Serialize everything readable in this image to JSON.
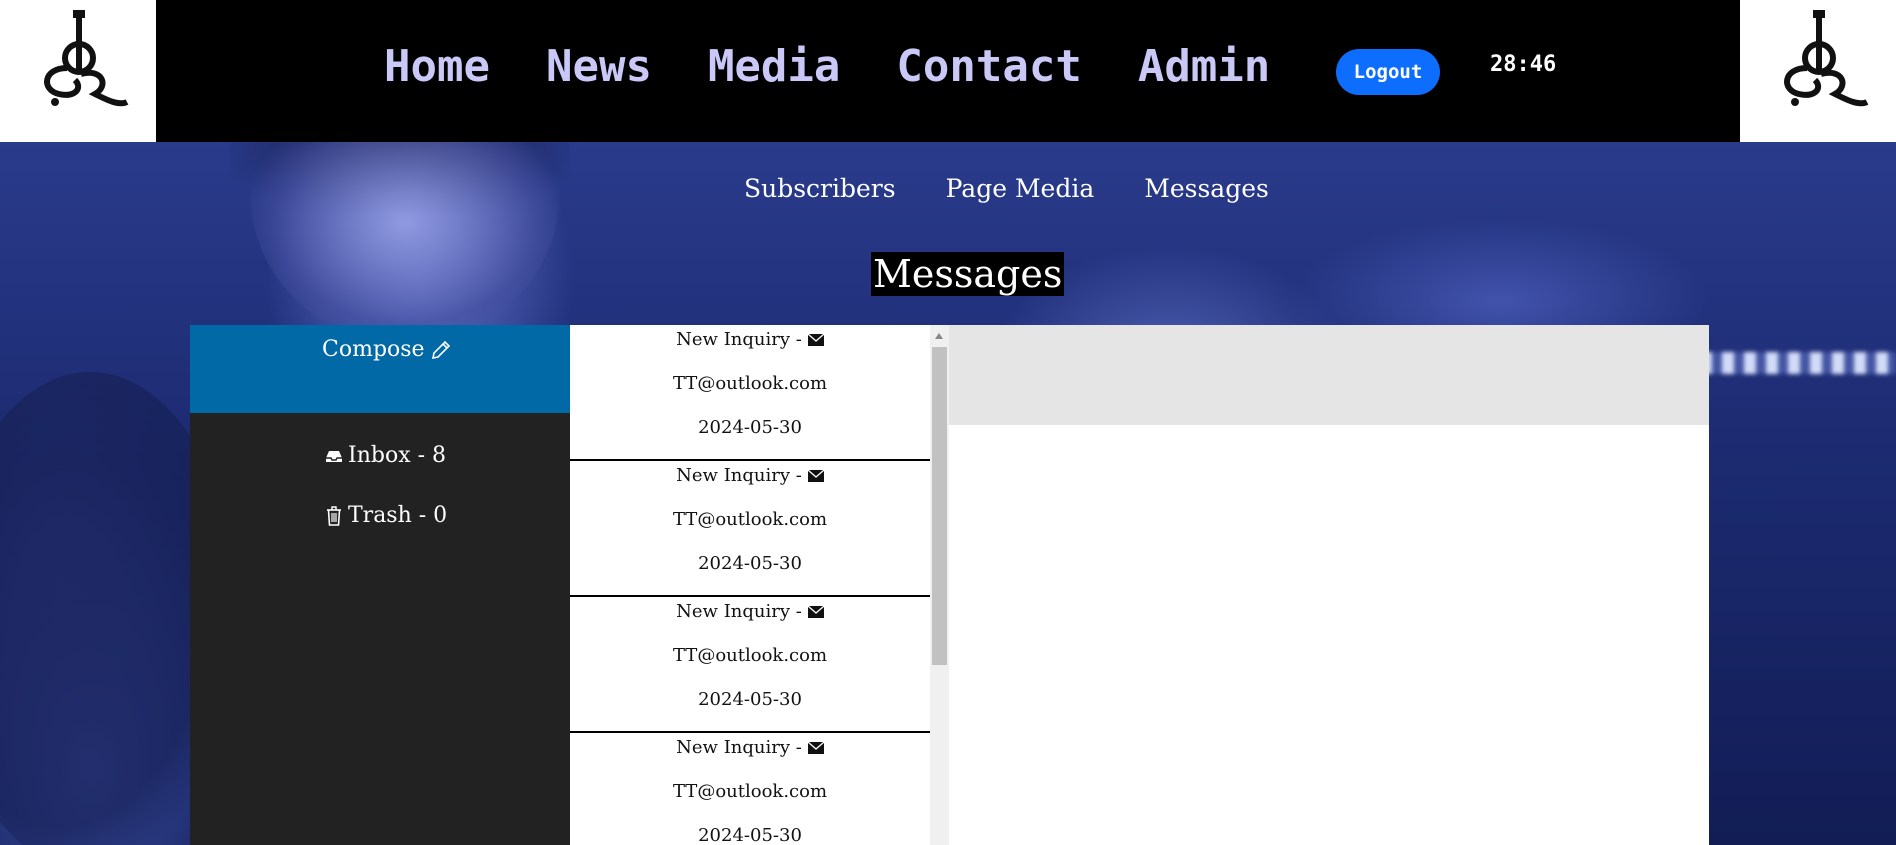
{
  "header": {
    "nav": [
      "Home",
      "News",
      "Media",
      "Contact",
      "Admin"
    ],
    "logout_label": "Logout",
    "timer": "28:46"
  },
  "subnav": {
    "items": [
      "Subscribers",
      "Page Media",
      "Messages"
    ]
  },
  "page_title": "Messages",
  "sidebar": {
    "compose_label": "Compose",
    "inbox_label": "Inbox - 8",
    "trash_label": "Trash - 0"
  },
  "messages": [
    {
      "subject": "New Inquiry -",
      "from": "TT@outlook.com",
      "date": "2024-05-30"
    },
    {
      "subject": "New Inquiry -",
      "from": "TT@outlook.com",
      "date": "2024-05-30"
    },
    {
      "subject": "New Inquiry -",
      "from": "TT@outlook.com",
      "date": "2024-05-30"
    },
    {
      "subject": "New Inquiry -",
      "from": "TT@outlook.com",
      "date": "2024-05-30"
    }
  ],
  "colors": {
    "header_bg": "#000000",
    "nav_text": "#c9c8f6",
    "logout_bg": "#0d6efd",
    "compose_bg": "#0069a6",
    "sidebar_bg": "#222222",
    "reader_header_bg": "#e5e5e5"
  },
  "icons": {
    "compose": "pencil-icon",
    "inbox": "inbox-tray-icon",
    "trash": "trash-icon",
    "message": "envelope-icon",
    "logo": "sr-guitar-logo"
  }
}
